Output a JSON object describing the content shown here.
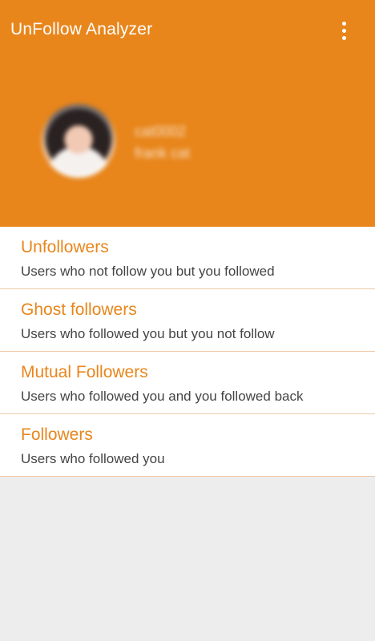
{
  "app_bar": {
    "title": "UnFollow Analyzer",
    "overflow_icon": "more-vert-icon"
  },
  "profile": {
    "username": "cat0002",
    "full_name": "frank cat"
  },
  "menu": [
    {
      "title": "Unfollowers",
      "description": "Users who not follow you but you followed"
    },
    {
      "title": "Ghost followers",
      "description": "Users who followed you but you not follow"
    },
    {
      "title": "Mutual Followers",
      "description": "Users who followed you and you followed back"
    },
    {
      "title": "Followers",
      "description": "Users who followed you"
    }
  ],
  "colors": {
    "accent": "#e8861c",
    "background": "#ededed",
    "divider": "#efc9a6"
  }
}
